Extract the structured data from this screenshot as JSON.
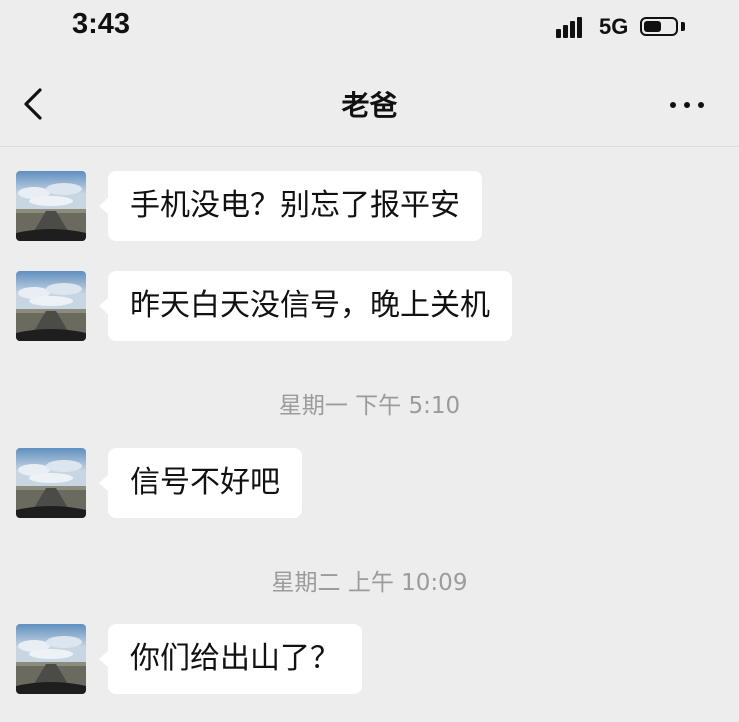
{
  "status_bar": {
    "time": "3:43",
    "network": "5G",
    "battery_level": 0.55
  },
  "nav": {
    "title": "老爸",
    "back_icon": "chevron-left-icon",
    "more_icon": "ellipsis-icon"
  },
  "messages": [
    {
      "type": "message",
      "text": "手机没电？别忘了报平安"
    },
    {
      "type": "message",
      "text": "昨天白天没信号，晚上关机"
    },
    {
      "type": "time",
      "text": "星期一 下午 5:10"
    },
    {
      "type": "message",
      "text": "信号不好吧"
    },
    {
      "type": "time",
      "text": "星期二 上午 10:09"
    },
    {
      "type": "message",
      "text": "你们给出山了？"
    }
  ],
  "colors": {
    "background": "#ededed",
    "bubble": "#ffffff",
    "timestamp": "#9b9b9b"
  }
}
